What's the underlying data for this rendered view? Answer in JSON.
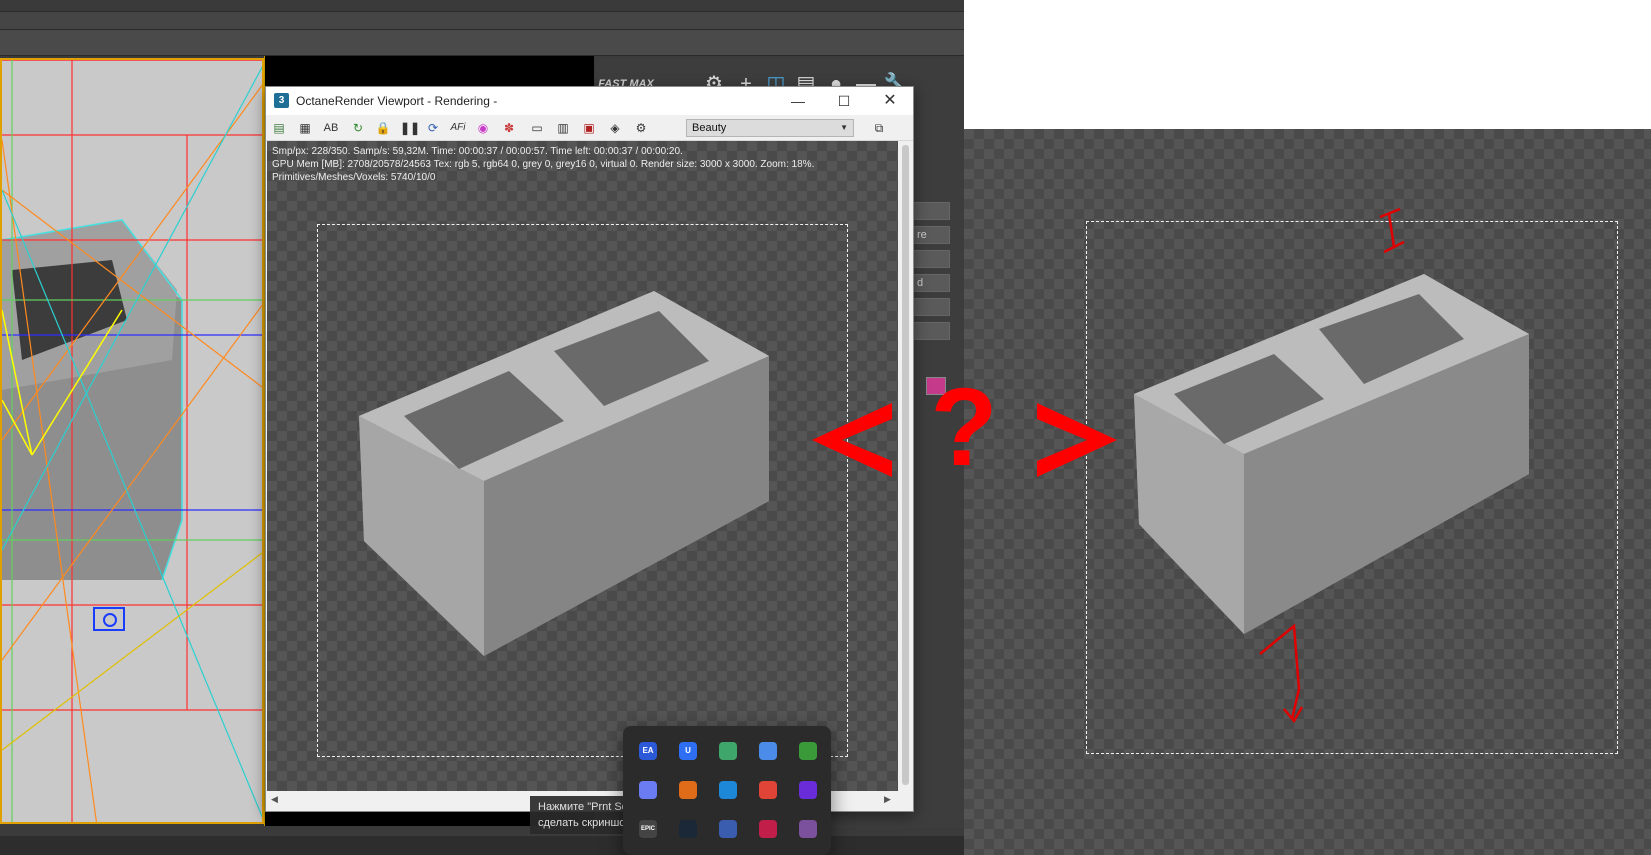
{
  "octane": {
    "app_icon": "3",
    "title": "OctaneRender Viewport - Rendering -",
    "pass_selected": "Beauty",
    "stats_line1": "Smp/px: 228/350.   Samp/s: 59,32M.   Time: 00:00:37 / 00:00:57.   Time left: 00:00:37 / 00:00:20.",
    "stats_line2": "GPU Mem [MB]: 2708/20578/24563   Tex: rgb 5, rgb64 0, grey 0, grey16 0, virtual 0.   Render size: 3000 x 3000.   Zoom: 18%.",
    "stats_line3": "Primitives/Meshes/Voxels: 5740/10/0",
    "toolbar_buttons": [
      "AB",
      "AFi"
    ]
  },
  "max": {
    "command_panel_fields": [
      "",
      "re",
      "",
      "d",
      "",
      ""
    ]
  },
  "question_sign": {
    "text": "<?>",
    "color": "#ff0000"
  },
  "tooltip": {
    "line1": "Нажмите \"Prnt Scrn\" на клавиатуре для того, чтобы",
    "line2": "сделать скриншот"
  },
  "tray": {
    "icons": [
      "ea-app-icon",
      "ubisoft-icon",
      "gamepass-icon",
      "drive-icon",
      "razer-icon",
      "copilot-icon",
      "origin-icon",
      "edge-icon",
      "chrome-icon",
      "arc-icon",
      "epic-games-icon",
      "steam-icon",
      "vpn-icon",
      "pocket-icon",
      "viber-icon"
    ],
    "icon_labels": [
      "EA",
      "U",
      "",
      "",
      "",
      "",
      "",
      "",
      "",
      "",
      "EPIC",
      "",
      "",
      "",
      ""
    ],
    "icon_colors": [
      "#2c59d8",
      "#2e6ef2",
      "#3fa66b",
      "#4a8ce8",
      "#3a9a3a",
      "#6b7cf2",
      "#e06c1a",
      "#1e88d8",
      "#e04436",
      "#6a2bd8",
      "#444444",
      "#1b2838",
      "#3a5db0",
      "#c21e4a",
      "#7b519d"
    ]
  }
}
